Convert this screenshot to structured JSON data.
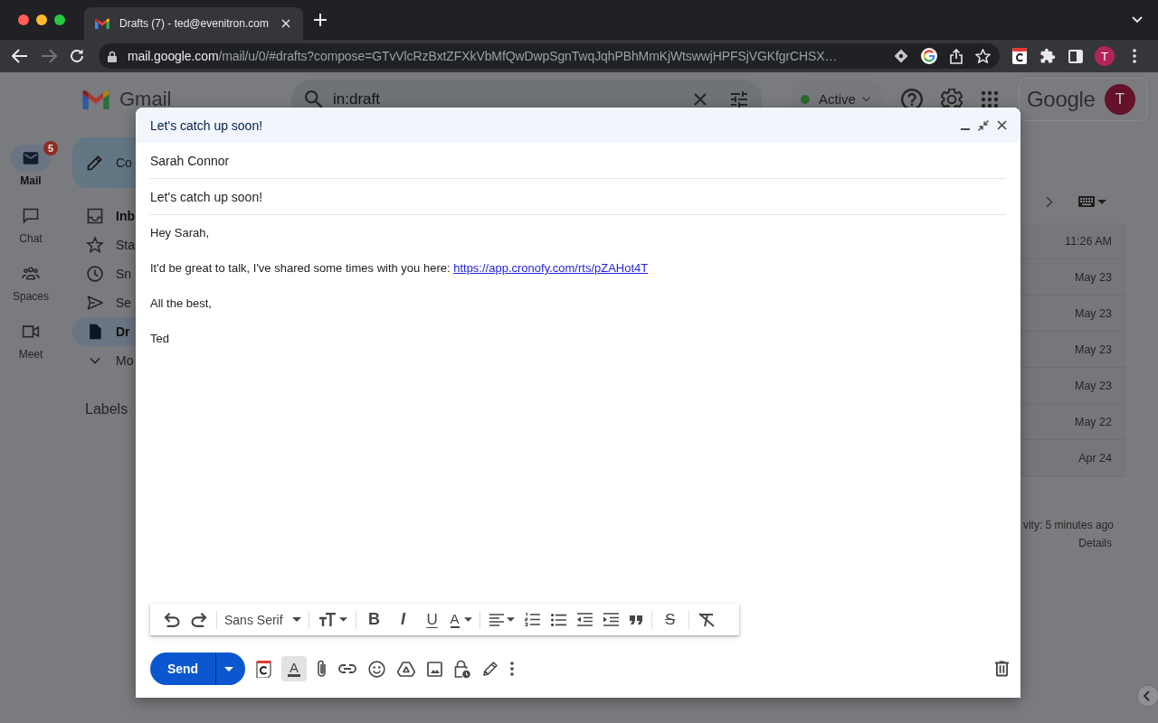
{
  "browser": {
    "tab": {
      "title": "Drafts (7) - ted@evenitron.com"
    },
    "forward_disabled": true,
    "url": {
      "host": "mail.google.com",
      "path": "/mail/u/0/#drafts?compose=GTvVlcRzBxtZFXkVbMfQwDwpSgnTwqJqhPBhMmKjWtswwjHPFSjVGKfgrCHSX…"
    },
    "profile_initial": "T"
  },
  "header": {
    "app_name": "Gmail",
    "search": {
      "value": "in:draft"
    },
    "status": "Active",
    "account": {
      "wordmark": "Google",
      "initial": "T"
    }
  },
  "rail": [
    {
      "label": "Mail",
      "badge": "5",
      "selected": true
    },
    {
      "label": "Chat",
      "selected": false
    },
    {
      "label": "Spaces",
      "selected": false
    },
    {
      "label": "Meet",
      "selected": false
    }
  ],
  "sidebar": {
    "compose": "Co",
    "items": [
      {
        "label": "Inb",
        "unread": true,
        "selected": false
      },
      {
        "label": "Sta",
        "unread": false,
        "selected": false
      },
      {
        "label": "Sn",
        "unread": false,
        "selected": false
      },
      {
        "label": "Se",
        "unread": false,
        "selected": false
      },
      {
        "label": "Dr",
        "unread": true,
        "selected": true
      },
      {
        "label": "Mo",
        "unread": false,
        "selected": false
      }
    ],
    "labels_heading": "Labels"
  },
  "message_list": {
    "rows": [
      {
        "date": "11:26 AM"
      },
      {
        "date": "May 23"
      },
      {
        "date": "May 23"
      },
      {
        "date": "May 23"
      },
      {
        "date": "May 23"
      },
      {
        "date": "May 22"
      },
      {
        "date": "Apr 24"
      }
    ],
    "activity": "vity: 5 minutes ago",
    "details": "Details"
  },
  "compose": {
    "title": "Let's catch up soon!",
    "to": "Sarah Connor",
    "subject": "Let's catch up soon!",
    "body": [
      {
        "text": "Hey Sarah,"
      },
      {
        "text": "It'd be great to talk, I've shared some times with you here:",
        "link": "https://app.cronofy.com/rts/pZAHot4T"
      },
      {
        "text": "All the best,"
      },
      {
        "text": "Ted"
      }
    ],
    "formatting_bar": {
      "font": "Sans Serif",
      "glyphs": [
        {
          "kind": "bold",
          "glyph": "B"
        },
        {
          "kind": "italic",
          "glyph": "I"
        },
        {
          "kind": "underline",
          "glyph": "U"
        },
        {
          "kind": "text_color",
          "glyph": "A"
        }
      ],
      "strike_glyph": "S"
    },
    "formatting_toggle": {
      "glyph": "A",
      "on": true
    },
    "send": "Send"
  }
}
